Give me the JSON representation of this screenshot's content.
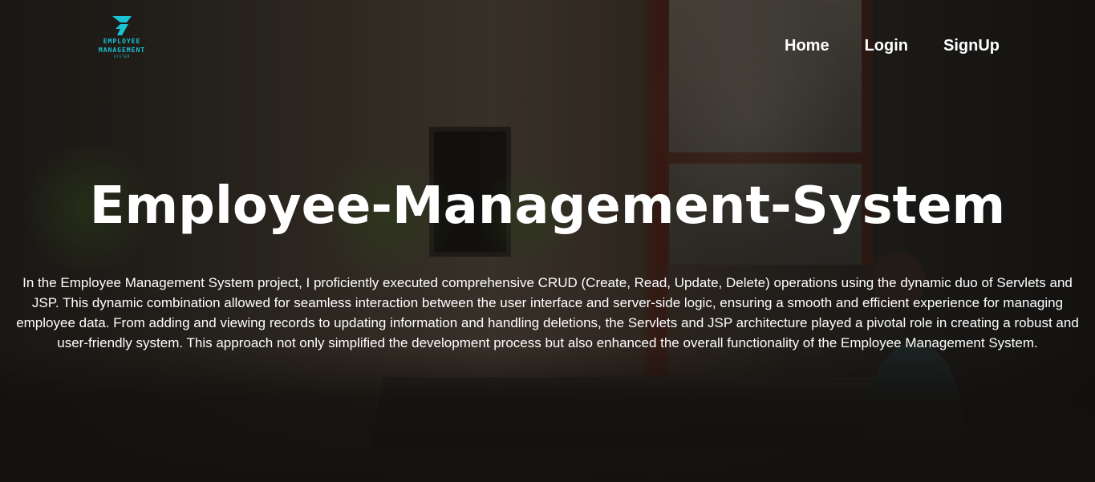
{
  "logo": {
    "line1": "EMPLOYEE",
    "line2": "MANAGEMENT",
    "line3": "SYSTEM",
    "color": "#19c4d6"
  },
  "nav": {
    "items": [
      {
        "label": "Home"
      },
      {
        "label": "Login"
      },
      {
        "label": "SignUp"
      }
    ]
  },
  "hero": {
    "title": "Employee-Management-System",
    "description": "In the Employee Management System project, I proficiently executed comprehensive CRUD (Create, Read, Update, Delete) operations using the dynamic duo of Servlets and JSP. This dynamic combination allowed for seamless interaction between the user interface and server-side logic, ensuring a smooth and efficient experience for managing employee data. From adding and viewing records to updating information and handling deletions, the Servlets and JSP architecture played a pivotal role in creating a robust and user-friendly system. This approach not only simplified the development process but also enhanced the overall functionality of the Employee Management System."
  }
}
